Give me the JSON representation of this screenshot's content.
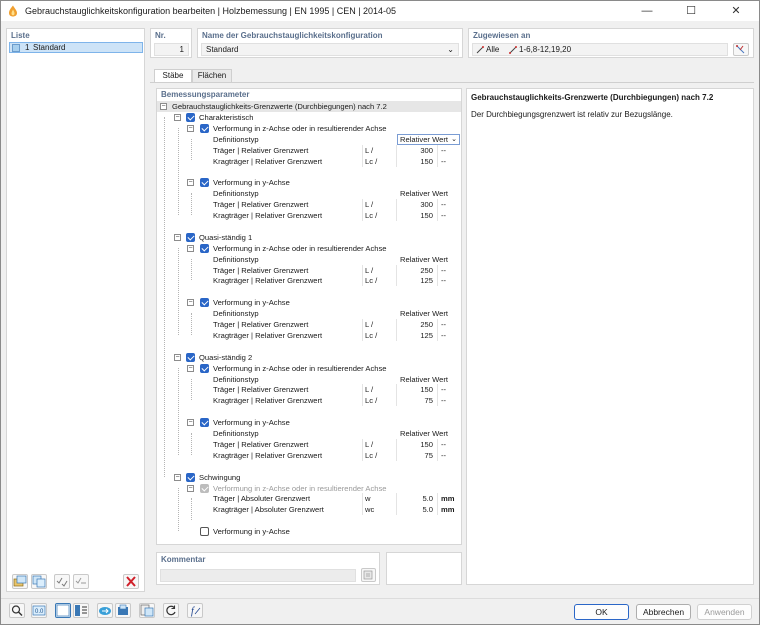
{
  "window": {
    "title": "Gebrauchstauglichkeitskonfiguration bearbeiten | Holzbemessung | EN 1995 | CEN | 2014-05",
    "minimize": "—",
    "maximize": "☐",
    "close": "✕"
  },
  "list": {
    "header": "Liste",
    "items": [
      {
        "number": "1",
        "name": "Standard"
      }
    ]
  },
  "config": {
    "nr_label": "Nr.",
    "nr_value": "1",
    "name_label": "Name der Gebrauchstauglichkeitskonfiguration",
    "name_value": "Standard",
    "assigned_label": "Zugewiesen an",
    "assigned_all": "Alle",
    "assigned_members": "1-6,8-12,19,20"
  },
  "tabs": [
    {
      "label": "Stäbe"
    },
    {
      "label": "Flächen"
    }
  ],
  "params": {
    "header": "Bemessungsparameter",
    "root": "Gebrauchstauglichkeits-Grenzwerte (Durchbiegungen) nach 7.2",
    "groups": [
      {
        "label": "Charakteristisch",
        "dirs": [
          {
            "label": "Verformung in z-Achse oder in resultierender Achse",
            "def_label": "Definitionstyp",
            "def_value": "Relativer Wert",
            "beam_label": "Träger | Relativer Grenzwert",
            "beam_sym": "L /",
            "beam_val": "300",
            "beam_unit": "--",
            "cant_label": "Kragträger | Relativer Grenzwert",
            "cant_sym": "Lc /",
            "cant_val": "150",
            "cant_unit": "--"
          },
          {
            "label": "Verformung in y-Achse",
            "def_label": "Definitionstyp",
            "def_value": "Relativer Wert",
            "beam_label": "Träger | Relativer Grenzwert",
            "beam_sym": "L /",
            "beam_val": "300",
            "beam_unit": "--",
            "cant_label": "Kragträger | Relativer Grenzwert",
            "cant_sym": "Lc /",
            "cant_val": "150",
            "cant_unit": "--"
          }
        ]
      },
      {
        "label": "Quasi-ständig 1",
        "dirs": [
          {
            "label": "Verformung in z-Achse oder in resultierender Achse",
            "def_label": "Definitionstyp",
            "def_value": "Relativer Wert",
            "beam_label": "Träger | Relativer Grenzwert",
            "beam_sym": "L /",
            "beam_val": "250",
            "beam_unit": "--",
            "cant_label": "Kragträger | Relativer Grenzwert",
            "cant_sym": "Lc /",
            "cant_val": "125",
            "cant_unit": "--"
          },
          {
            "label": "Verformung in y-Achse",
            "def_label": "Definitionstyp",
            "def_value": "Relativer Wert",
            "beam_label": "Träger | Relativer Grenzwert",
            "beam_sym": "L /",
            "beam_val": "250",
            "beam_unit": "--",
            "cant_label": "Kragträger | Relativer Grenzwert",
            "cant_sym": "Lc /",
            "cant_val": "125",
            "cant_unit": "--"
          }
        ]
      },
      {
        "label": "Quasi-ständig 2",
        "dirs": [
          {
            "label": "Verformung in z-Achse oder in resultierender Achse",
            "def_label": "Definitionstyp",
            "def_value": "Relativer Wert",
            "beam_label": "Träger | Relativer Grenzwert",
            "beam_sym": "L /",
            "beam_val": "150",
            "beam_unit": "--",
            "cant_label": "Kragträger | Relativer Grenzwert",
            "cant_sym": "Lc /",
            "cant_val": "75",
            "cant_unit": "--"
          },
          {
            "label": "Verformung in y-Achse",
            "def_label": "Definitionstyp",
            "def_value": "Relativer Wert",
            "beam_label": "Träger | Relativer Grenzwert",
            "beam_sym": "L /",
            "beam_val": "150",
            "beam_unit": "--",
            "cant_label": "Kragträger | Relativer Grenzwert",
            "cant_sym": "Lc /",
            "cant_val": "75",
            "cant_unit": "--"
          }
        ]
      }
    ],
    "vibration": {
      "label": "Schwingung",
      "z_label": "Verformung in z-Achse oder in resultierender Achse",
      "beam_label": "Träger | Absoluter Grenzwert",
      "beam_sym": "w",
      "beam_val": "5.0",
      "beam_unit": "mm",
      "cant_label": "Kragträger | Absoluter Grenzwert",
      "cant_sym": "wc",
      "cant_val": "5.0",
      "cant_unit": "mm",
      "y_label": "Verformung in y-Achse"
    }
  },
  "info": {
    "title": "Gebrauchstauglichkeits-Grenzwerte (Durchbiegungen) nach 7.2",
    "text": "Der Durchbiegungsgrenzwert ist relativ zur Bezugslänge."
  },
  "comment": {
    "label": "Kommentar"
  },
  "buttons": {
    "ok": "OK",
    "cancel": "Abbrechen",
    "apply": "Anwenden"
  }
}
